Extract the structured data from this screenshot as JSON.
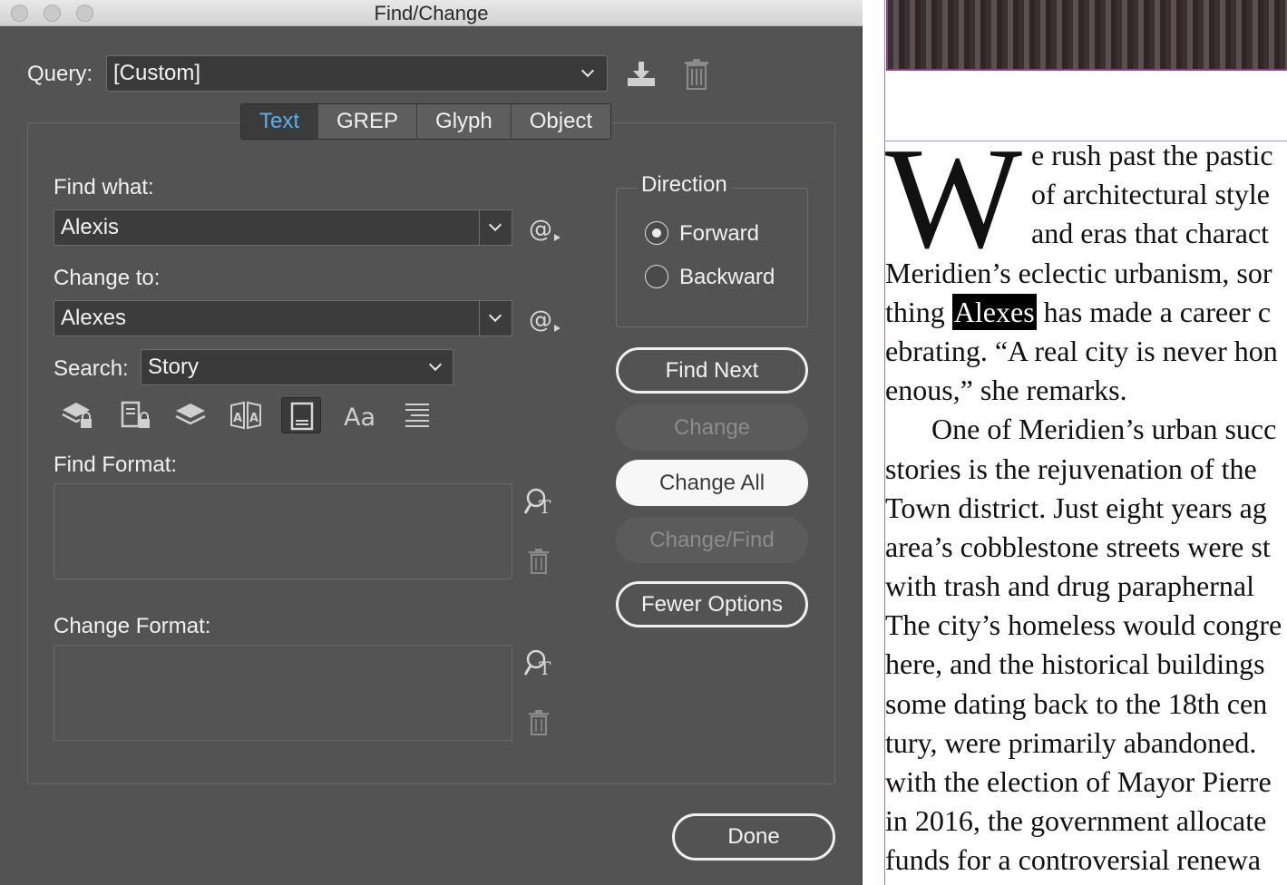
{
  "window": {
    "title": "Find/Change"
  },
  "query": {
    "label": "Query:",
    "value": "[Custom]"
  },
  "tabs": [
    {
      "label": "Text",
      "active": true
    },
    {
      "label": "GREP",
      "active": false
    },
    {
      "label": "Glyph",
      "active": false
    },
    {
      "label": "Object",
      "active": false
    }
  ],
  "find_what": {
    "label": "Find what:",
    "value": "Alexis"
  },
  "change_to": {
    "label": "Change to:",
    "value": "Alexes"
  },
  "search": {
    "label": "Search:",
    "value": "Story"
  },
  "direction": {
    "legend": "Direction",
    "forward": "Forward",
    "backward": "Backward",
    "selected": "Forward"
  },
  "buttons": {
    "find_next": "Find Next",
    "change": "Change",
    "change_all": "Change All",
    "change_find": "Change/Find",
    "fewer_options": "Fewer Options",
    "done": "Done"
  },
  "find_format": {
    "label": "Find Format:"
  },
  "change_format": {
    "label": "Change Format:"
  },
  "options_icons": [
    "locked-layers-icon",
    "locked-stories-icon",
    "hidden-layers-icon",
    "master-pages-icon",
    "footnotes-icon",
    "case-sensitive-icon",
    "whole-word-icon"
  ],
  "document": {
    "dropcap": "W",
    "lines": [
      {
        "pre": "e rush past the pastic",
        "hl": "",
        "post": ""
      },
      {
        "pre": "of architectural style",
        "hl": "",
        "post": ""
      },
      {
        "pre": "and eras that charact",
        "hl": "",
        "post": ""
      },
      {
        "pre": "Meridien’s eclectic urbanism, sor",
        "hl": "",
        "post": ""
      },
      {
        "pre": "thing ",
        "hl": "Alexes",
        "post": " has made a career c"
      },
      {
        "pre": "ebrating. “A real city is never hon",
        "hl": "",
        "post": ""
      },
      {
        "pre": "enous,” she remarks.",
        "hl": "",
        "post": ""
      },
      {
        "pre": "One of Meridien’s urban succ",
        "hl": "",
        "post": ""
      },
      {
        "pre": "stories is the rejuvenation of the",
        "hl": "",
        "post": ""
      },
      {
        "pre": "Town district. Just eight years ag",
        "hl": "",
        "post": ""
      },
      {
        "pre": "area’s cobblestone streets were st",
        "hl": "",
        "post": ""
      },
      {
        "pre": "with trash and drug paraphernal",
        "hl": "",
        "post": ""
      },
      {
        "pre": "The city’s homeless would congre",
        "hl": "",
        "post": ""
      },
      {
        "pre": "here, and the historical buildings",
        "hl": "",
        "post": ""
      },
      {
        "pre": "some dating back to the 18th cen",
        "hl": "",
        "post": ""
      },
      {
        "pre": "tury, were primarily abandoned.",
        "hl": "",
        "post": ""
      },
      {
        "pre": "with the election of Mayor Pierre",
        "hl": "",
        "post": ""
      },
      {
        "pre": "in 2016, the government allocate",
        "hl": "",
        "post": ""
      },
      {
        "pre": "funds for a controversial renewa",
        "hl": "",
        "post": ""
      }
    ]
  }
}
